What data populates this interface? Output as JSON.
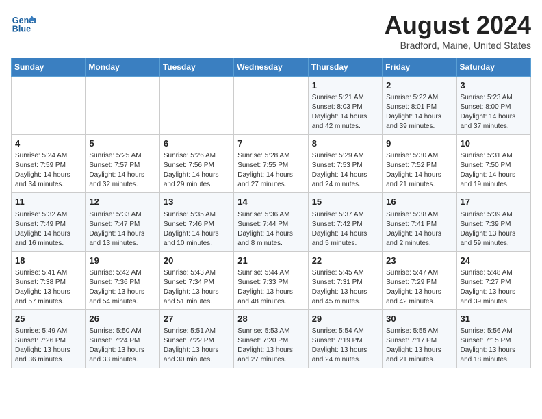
{
  "logo": {
    "line1": "General",
    "line2": "Blue"
  },
  "title": "August 2024",
  "location": "Bradford, Maine, United States",
  "days_of_week": [
    "Sunday",
    "Monday",
    "Tuesday",
    "Wednesday",
    "Thursday",
    "Friday",
    "Saturday"
  ],
  "weeks": [
    [
      {
        "day": "",
        "info": ""
      },
      {
        "day": "",
        "info": ""
      },
      {
        "day": "",
        "info": ""
      },
      {
        "day": "",
        "info": ""
      },
      {
        "day": "1",
        "info": "Sunrise: 5:21 AM\nSunset: 8:03 PM\nDaylight: 14 hours\nand 42 minutes."
      },
      {
        "day": "2",
        "info": "Sunrise: 5:22 AM\nSunset: 8:01 PM\nDaylight: 14 hours\nand 39 minutes."
      },
      {
        "day": "3",
        "info": "Sunrise: 5:23 AM\nSunset: 8:00 PM\nDaylight: 14 hours\nand 37 minutes."
      }
    ],
    [
      {
        "day": "4",
        "info": "Sunrise: 5:24 AM\nSunset: 7:59 PM\nDaylight: 14 hours\nand 34 minutes."
      },
      {
        "day": "5",
        "info": "Sunrise: 5:25 AM\nSunset: 7:57 PM\nDaylight: 14 hours\nand 32 minutes."
      },
      {
        "day": "6",
        "info": "Sunrise: 5:26 AM\nSunset: 7:56 PM\nDaylight: 14 hours\nand 29 minutes."
      },
      {
        "day": "7",
        "info": "Sunrise: 5:28 AM\nSunset: 7:55 PM\nDaylight: 14 hours\nand 27 minutes."
      },
      {
        "day": "8",
        "info": "Sunrise: 5:29 AM\nSunset: 7:53 PM\nDaylight: 14 hours\nand 24 minutes."
      },
      {
        "day": "9",
        "info": "Sunrise: 5:30 AM\nSunset: 7:52 PM\nDaylight: 14 hours\nand 21 minutes."
      },
      {
        "day": "10",
        "info": "Sunrise: 5:31 AM\nSunset: 7:50 PM\nDaylight: 14 hours\nand 19 minutes."
      }
    ],
    [
      {
        "day": "11",
        "info": "Sunrise: 5:32 AM\nSunset: 7:49 PM\nDaylight: 14 hours\nand 16 minutes."
      },
      {
        "day": "12",
        "info": "Sunrise: 5:33 AM\nSunset: 7:47 PM\nDaylight: 14 hours\nand 13 minutes."
      },
      {
        "day": "13",
        "info": "Sunrise: 5:35 AM\nSunset: 7:46 PM\nDaylight: 14 hours\nand 10 minutes."
      },
      {
        "day": "14",
        "info": "Sunrise: 5:36 AM\nSunset: 7:44 PM\nDaylight: 14 hours\nand 8 minutes."
      },
      {
        "day": "15",
        "info": "Sunrise: 5:37 AM\nSunset: 7:42 PM\nDaylight: 14 hours\nand 5 minutes."
      },
      {
        "day": "16",
        "info": "Sunrise: 5:38 AM\nSunset: 7:41 PM\nDaylight: 14 hours\nand 2 minutes."
      },
      {
        "day": "17",
        "info": "Sunrise: 5:39 AM\nSunset: 7:39 PM\nDaylight: 13 hours\nand 59 minutes."
      }
    ],
    [
      {
        "day": "18",
        "info": "Sunrise: 5:41 AM\nSunset: 7:38 PM\nDaylight: 13 hours\nand 57 minutes."
      },
      {
        "day": "19",
        "info": "Sunrise: 5:42 AM\nSunset: 7:36 PM\nDaylight: 13 hours\nand 54 minutes."
      },
      {
        "day": "20",
        "info": "Sunrise: 5:43 AM\nSunset: 7:34 PM\nDaylight: 13 hours\nand 51 minutes."
      },
      {
        "day": "21",
        "info": "Sunrise: 5:44 AM\nSunset: 7:33 PM\nDaylight: 13 hours\nand 48 minutes."
      },
      {
        "day": "22",
        "info": "Sunrise: 5:45 AM\nSunset: 7:31 PM\nDaylight: 13 hours\nand 45 minutes."
      },
      {
        "day": "23",
        "info": "Sunrise: 5:47 AM\nSunset: 7:29 PM\nDaylight: 13 hours\nand 42 minutes."
      },
      {
        "day": "24",
        "info": "Sunrise: 5:48 AM\nSunset: 7:27 PM\nDaylight: 13 hours\nand 39 minutes."
      }
    ],
    [
      {
        "day": "25",
        "info": "Sunrise: 5:49 AM\nSunset: 7:26 PM\nDaylight: 13 hours\nand 36 minutes."
      },
      {
        "day": "26",
        "info": "Sunrise: 5:50 AM\nSunset: 7:24 PM\nDaylight: 13 hours\nand 33 minutes."
      },
      {
        "day": "27",
        "info": "Sunrise: 5:51 AM\nSunset: 7:22 PM\nDaylight: 13 hours\nand 30 minutes."
      },
      {
        "day": "28",
        "info": "Sunrise: 5:53 AM\nSunset: 7:20 PM\nDaylight: 13 hours\nand 27 minutes."
      },
      {
        "day": "29",
        "info": "Sunrise: 5:54 AM\nSunset: 7:19 PM\nDaylight: 13 hours\nand 24 minutes."
      },
      {
        "day": "30",
        "info": "Sunrise: 5:55 AM\nSunset: 7:17 PM\nDaylight: 13 hours\nand 21 minutes."
      },
      {
        "day": "31",
        "info": "Sunrise: 5:56 AM\nSunset: 7:15 PM\nDaylight: 13 hours\nand 18 minutes."
      }
    ]
  ]
}
